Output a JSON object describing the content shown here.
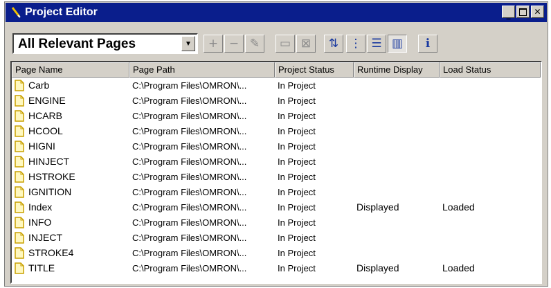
{
  "window": {
    "title": "Project Editor"
  },
  "toolbar": {
    "filter_value": "All Relevant Pages",
    "tools": [
      {
        "name": "add-page-button",
        "glyph": "+",
        "active": false,
        "pressed": false
      },
      {
        "name": "remove-page-button",
        "glyph": "−",
        "active": false,
        "pressed": false
      },
      {
        "name": "edit-page-button",
        "glyph": "✎",
        "active": false,
        "pressed": false
      },
      {
        "name": "display-page-button",
        "glyph": "▭",
        "active": false,
        "pressed": false
      },
      {
        "name": "close-page-button",
        "glyph": "⊠",
        "active": false,
        "pressed": false
      },
      {
        "name": "sort-button",
        "glyph": "⇅",
        "active": true,
        "pressed": false
      },
      {
        "name": "tree-view-button",
        "glyph": "⋮",
        "active": true,
        "pressed": false
      },
      {
        "name": "list-view-button",
        "glyph": "☰",
        "active": true,
        "pressed": false
      },
      {
        "name": "details-view-button",
        "glyph": "▥",
        "active": true,
        "pressed": true
      },
      {
        "name": "info-button",
        "glyph": "ℹ",
        "active": true,
        "pressed": false
      }
    ]
  },
  "list": {
    "columns": [
      "Page Name",
      "Page Path",
      "Project Status",
      "Runtime Display",
      "Load Status"
    ],
    "rows": [
      {
        "name": "Carb",
        "path": "C:\\Program Files\\OMRON\\...",
        "status": "In Project",
        "runtime": "",
        "load": ""
      },
      {
        "name": "ENGINE",
        "path": "C:\\Program Files\\OMRON\\...",
        "status": "In Project",
        "runtime": "",
        "load": ""
      },
      {
        "name": "HCARB",
        "path": "C:\\Program Files\\OMRON\\...",
        "status": "In Project",
        "runtime": "",
        "load": ""
      },
      {
        "name": "HCOOL",
        "path": "C:\\Program Files\\OMRON\\...",
        "status": "In Project",
        "runtime": "",
        "load": ""
      },
      {
        "name": "HIGNI",
        "path": "C:\\Program Files\\OMRON\\...",
        "status": "In Project",
        "runtime": "",
        "load": ""
      },
      {
        "name": "HINJECT",
        "path": "C:\\Program Files\\OMRON\\...",
        "status": "In Project",
        "runtime": "",
        "load": ""
      },
      {
        "name": "HSTROKE",
        "path": "C:\\Program Files\\OMRON\\...",
        "status": "In Project",
        "runtime": "",
        "load": ""
      },
      {
        "name": "IGNITION",
        "path": "C:\\Program Files\\OMRON\\...",
        "status": "In Project",
        "runtime": "",
        "load": ""
      },
      {
        "name": "Index",
        "path": "C:\\Program Files\\OMRON\\...",
        "status": "In Project",
        "runtime": "Displayed",
        "load": "Loaded"
      },
      {
        "name": "INFO",
        "path": "C:\\Program Files\\OMRON\\...",
        "status": "In Project",
        "runtime": "",
        "load": ""
      },
      {
        "name": "INJECT",
        "path": "C:\\Program Files\\OMRON\\...",
        "status": "In Project",
        "runtime": "",
        "load": ""
      },
      {
        "name": "STROKE4",
        "path": "C:\\Program Files\\OMRON\\...",
        "status": "In Project",
        "runtime": "",
        "load": ""
      },
      {
        "name": "TITLE",
        "path": "C:\\Program Files\\OMRON\\...",
        "status": "In Project",
        "runtime": "Displayed",
        "load": "Loaded"
      }
    ]
  }
}
